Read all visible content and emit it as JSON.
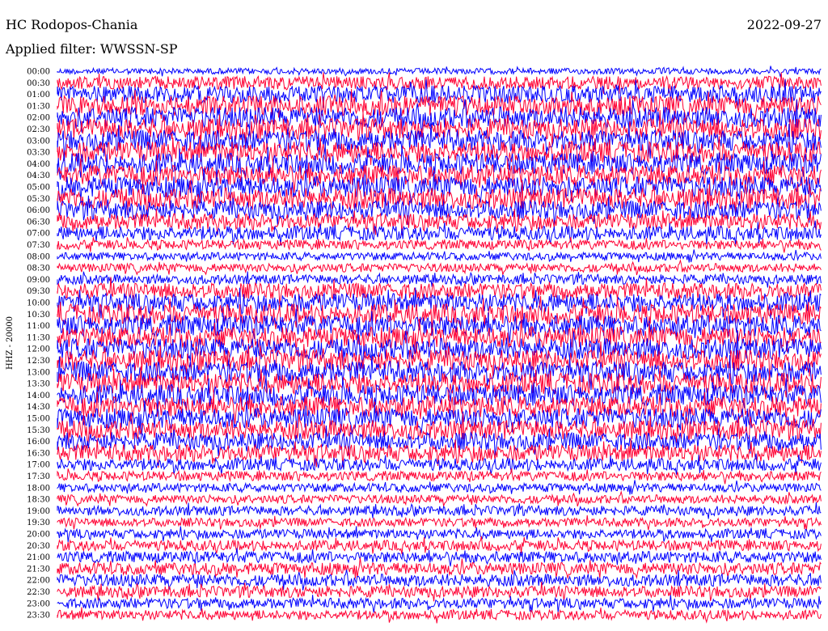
{
  "header": {
    "station": "HC Rodopos-Chania",
    "date": "2022-09-27",
    "filter_label": "Applied filter: WWSSN-SP"
  },
  "channel_label": "HHZ - 20000",
  "colors": {
    "odd_trace": "#0000ff",
    "even_trace": "#ff0033",
    "background": "#ffffff"
  },
  "chart_data": {
    "type": "line",
    "subtype": "helicorder",
    "row_minutes": 30,
    "tick_labels": [
      "00:00",
      "00:30",
      "01:00",
      "01:30",
      "02:00",
      "02:30",
      "03:00",
      "03:30",
      "04:00",
      "04:30",
      "05:00",
      "05:30",
      "06:00",
      "06:30",
      "07:00",
      "07:30",
      "08:00",
      "08:30",
      "09:00",
      "09:30",
      "10:00",
      "10:30",
      "11:00",
      "11:30",
      "12:00",
      "12:30",
      "13:00",
      "13:30",
      "14:00",
      "14:30",
      "15:00",
      "15:30",
      "16:00",
      "16:30",
      "17:00",
      "17:30",
      "18:00",
      "18:30",
      "19:00",
      "19:30",
      "20:00",
      "20:30",
      "21:00",
      "21:30",
      "22:00",
      "22:30",
      "23:00",
      "23:30"
    ],
    "series": [
      {
        "color": "#0000ff",
        "rows": "00:00, 01:00, 02:00 … 23:00"
      },
      {
        "color": "#ff0033",
        "rows": "00:30, 01:30, 02:30 … 23:30"
      }
    ],
    "relative_amplitude": [
      0.15,
      0.55,
      0.8,
      0.95,
      1.0,
      1.0,
      1.0,
      1.0,
      1.0,
      1.0,
      1.0,
      1.0,
      0.85,
      0.7,
      0.6,
      0.35,
      0.25,
      0.3,
      0.35,
      0.7,
      0.85,
      0.95,
      1.0,
      1.0,
      1.0,
      1.0,
      1.0,
      1.0,
      1.0,
      1.0,
      0.95,
      0.9,
      0.8,
      0.75,
      0.5,
      0.35,
      0.3,
      0.3,
      0.35,
      0.3,
      0.35,
      0.4,
      0.45,
      0.5,
      0.5,
      0.45,
      0.4,
      0.35
    ],
    "grid": false,
    "legend": "none"
  }
}
